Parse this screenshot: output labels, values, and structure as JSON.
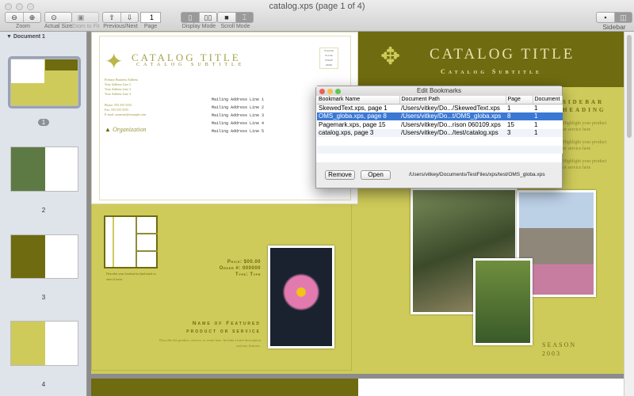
{
  "window": {
    "title": "catalog.xps (page 1 of 4)"
  },
  "toolbar": {
    "zoom_label": "Zoom",
    "actual_size_label": "Actual Size",
    "zoom_to_fit_label": "Zoom to Fit",
    "prev_next_label": "Previous/Next",
    "page_label": "Page",
    "page_value": "1",
    "display_mode_label": "Display Mode",
    "scroll_mode_label": "Scroll Mode",
    "sidebar_label": "Sidebar"
  },
  "sidebar": {
    "document": "Document 1",
    "pages": [
      "1",
      "2",
      "3",
      "4"
    ]
  },
  "left_page": {
    "title": "CATALOG TITLE",
    "subtitle": "CATALOG SUBTITLE",
    "stamp": [
      "PLEASE",
      "PLACE",
      "STAMP",
      "HERE"
    ],
    "address": [
      "Primary Business Address",
      "Your Address Line 2",
      "Your Address Line 3",
      "Your Address Line 4"
    ],
    "contact": [
      "Phone: 555 555 5555",
      "Fax: 555 555 5555",
      "E-mail: someone@example.com"
    ],
    "organization": "Organization",
    "mailing": [
      "Mailing Address Line 1",
      "Mailing Address Line 2",
      "Mailing Address Line 3",
      "Mailing Address Line 4",
      "Mailing Address Line 5"
    ],
    "map_caption": "Describe your location by land mark or area of town.",
    "price": "Price: $00.00",
    "order": "Order #: 000000",
    "type": "Type: Type",
    "featured_1": "Name of Featured",
    "featured_2": "product or service",
    "featured_desc": "Describe the product, service, or event here. Include a brief description and any features."
  },
  "right_page": {
    "title": "CATALOG TITLE",
    "subtitle": "Catalog Subtitle",
    "sidebar_heading_1": "SIDEBAR",
    "sidebar_heading_2": "HEADING",
    "highlight": "Highlight your product or service here",
    "season": "Season",
    "year": "2003"
  },
  "dialog": {
    "title": "Edit Bookmarks",
    "columns": [
      "Bookmark Name",
      "Document Path",
      "Page",
      "Document"
    ],
    "rows": [
      [
        "SkewedText.xps, page 1",
        "/Users/vitkey/Do.../SkewedText.xps",
        "1",
        "1"
      ],
      [
        "OMS_globa.xps, page 8",
        "/Users/vitkey/Do...t/OMS_globa.xps",
        "8",
        "1"
      ],
      [
        "Pagemark.xps, page 15",
        "/Users/vitkey/Do...rison 060109.xps",
        "15",
        "1"
      ],
      [
        "catalog.xps, page 3",
        "/Users/vitkey/Do.../test/catalog.xps",
        "3",
        "1"
      ]
    ],
    "selected_row": 1,
    "remove_label": "Remove",
    "open_label": "Open",
    "path": "/Users/vitkey/Documents/TestFiles/xps/test/OMS_globa.xps"
  }
}
